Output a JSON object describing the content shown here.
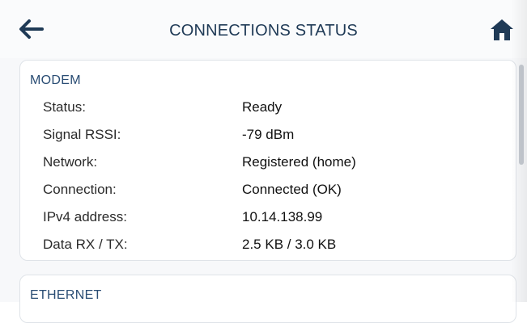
{
  "header": {
    "title": "CONNECTIONS STATUS",
    "back_icon": "arrow-left-icon",
    "home_icon": "home-icon"
  },
  "sections": {
    "modem": {
      "title": "MODEM",
      "rows": [
        {
          "label": "Status:",
          "value": "Ready"
        },
        {
          "label": "Signal RSSI:",
          "value": "-79 dBm"
        },
        {
          "label": "Network:",
          "value": "Registered (home)"
        },
        {
          "label": "Connection:",
          "value": "Connected (OK)"
        },
        {
          "label": "IPv4 address:",
          "value": "10.14.138.99"
        },
        {
          "label": "Data RX / TX:",
          "value": "2.5 KB / 3.0 KB"
        }
      ]
    },
    "ethernet": {
      "title": "ETHERNET"
    }
  },
  "colors": {
    "title": "#1f3a56",
    "section_title": "#2a4d74",
    "card_border": "#dfe3e8",
    "icon": "#1f3a56"
  }
}
